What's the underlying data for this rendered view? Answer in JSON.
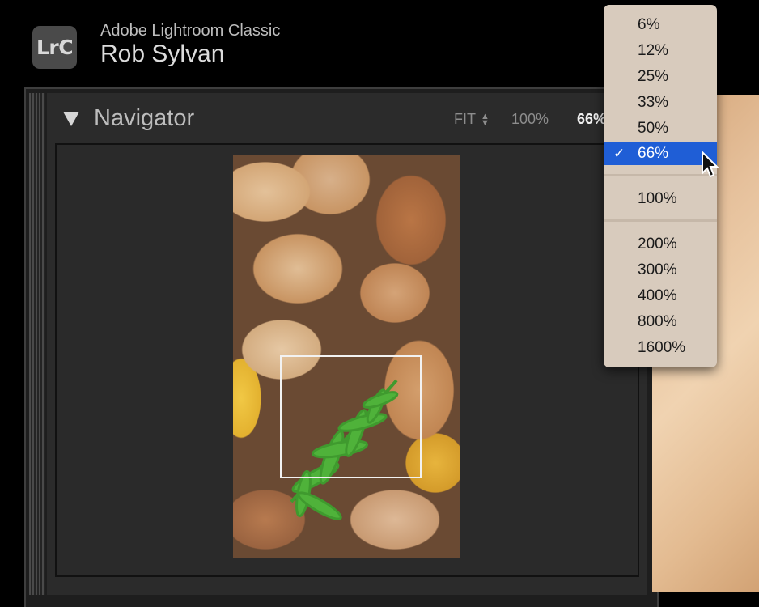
{
  "header": {
    "logo_text": "LrC",
    "app_title": "Adobe Lightroom Classic",
    "user_name": "Rob Sylvan"
  },
  "navigator": {
    "title": "Navigator",
    "zoom_fit": "FIT",
    "zoom_100": "100%",
    "zoom_current": "66%"
  },
  "zoom_menu": {
    "items": [
      "6%",
      "12%",
      "25%",
      "33%",
      "50%",
      "66%",
      "100%",
      "200%",
      "300%",
      "400%",
      "800%",
      "1600%"
    ],
    "selected": "66%",
    "checkmark": "✓"
  },
  "colors": {
    "menu_background": "#d8cbbd",
    "selection": "#1f5ed6",
    "panel": "#2b2b2b"
  }
}
